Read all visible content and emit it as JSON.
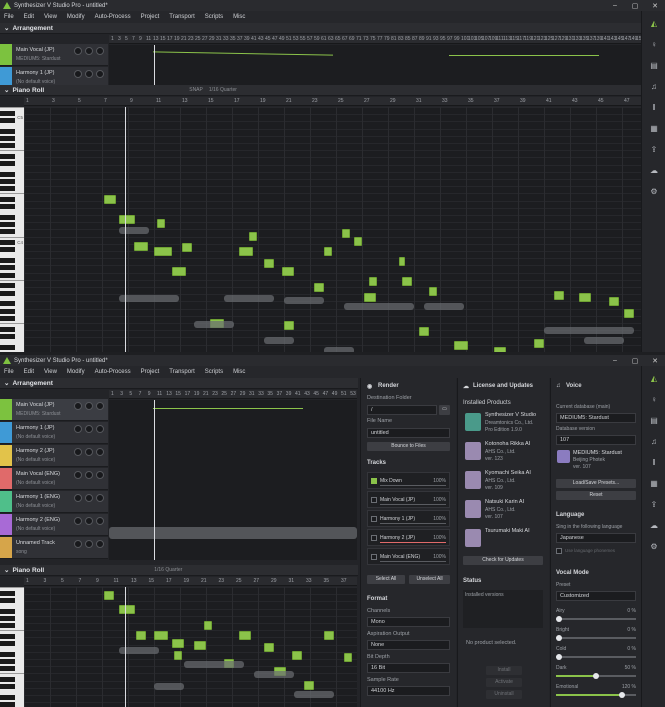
{
  "app": {
    "title": "Synthesizer V Studio Pro - untitled*"
  },
  "window_controls": {
    "min": "–",
    "max": "▢",
    "close": "✕"
  },
  "menu": [
    "File",
    "Edit",
    "View",
    "Modify",
    "Auto-Process",
    "Project",
    "Transport",
    "Scripts",
    "Misc"
  ],
  "arrangement": {
    "label": "Arrangement"
  },
  "piano_roll": {
    "label": "Piano Roll",
    "snap": "SNAP",
    "quantize": "1/16 Quarter"
  },
  "ruler1": [
    "1",
    "3",
    "5",
    "7",
    "9",
    "11",
    "13",
    "15",
    "17",
    "19",
    "21",
    "23",
    "25",
    "27",
    "29",
    "31",
    "33",
    "35",
    "37",
    "39",
    "41",
    "43",
    "45",
    "47",
    "49",
    "51",
    "53",
    "55",
    "57",
    "59",
    "61",
    "63",
    "65",
    "67",
    "69",
    "71",
    "73",
    "75",
    "77",
    "79",
    "81",
    "83",
    "85",
    "87",
    "89",
    "91",
    "93",
    "95",
    "97",
    "99",
    "101",
    "103",
    "105",
    "107",
    "109",
    "111",
    "113",
    "115",
    "117",
    "119",
    "121",
    "123",
    "125",
    "127",
    "129",
    "131",
    "133",
    "135",
    "137",
    "139",
    "141",
    "143",
    "145",
    "147",
    "149",
    "150"
  ],
  "ruler_piano": [
    "1",
    "3",
    "5",
    "7",
    "9",
    "11",
    "13",
    "15",
    "17",
    "19",
    "21",
    "23",
    "25",
    "27",
    "29",
    "31",
    "33",
    "35",
    "37",
    "39",
    "41",
    "43",
    "45",
    "47"
  ],
  "ruler2": [
    "1",
    "3",
    "5",
    "7",
    "9",
    "11",
    "13",
    "15",
    "17",
    "19",
    "21",
    "23",
    "25",
    "27",
    "29",
    "31",
    "33",
    "35",
    "37",
    "39",
    "41",
    "43",
    "45",
    "47",
    "49",
    "51",
    "53"
  ],
  "ruler_piano2": [
    "1",
    "3",
    "5",
    "7",
    "9",
    "11",
    "13",
    "15",
    "17",
    "19",
    "21",
    "23",
    "25",
    "27",
    "29",
    "31",
    "33",
    "35",
    "37"
  ],
  "tracks_top": [
    {
      "name": "Main Vocal (JP)",
      "voice": "MEDIUM5: Stardust",
      "color": "#7cc23f"
    },
    {
      "name": "Harmony 1 (JP)",
      "voice": "(No default voice)",
      "color": "#3f9ad6"
    }
  ],
  "tracks_bottom": [
    {
      "name": "Main Vocal (JP)",
      "voice": "MEDIUM5: Stardust",
      "color": "#7cc23f"
    },
    {
      "name": "Harmony 1 (JP)",
      "voice": "(No default voice)",
      "color": "#3f9ad6"
    },
    {
      "name": "Harmony 2 (JP)",
      "voice": "(No default voice)",
      "color": "#e2c34a"
    },
    {
      "name": "Main Vocal (ENG)",
      "voice": "(No default voice)",
      "color": "#e06a6a"
    },
    {
      "name": "Harmony 1 (ENG)",
      "voice": "(No default voice)",
      "color": "#4fbf8a"
    },
    {
      "name": "Harmony 2 (ENG)",
      "voice": "(No default voice)",
      "color": "#a86ad6"
    },
    {
      "name": "Unnamed Track",
      "voice": "song",
      "color": "#d6a54a"
    }
  ],
  "piano_octaves": [
    "C5",
    "C4"
  ],
  "render": {
    "title": "Render",
    "dest_label": "Destination Folder",
    "dest_value": "/",
    "file_label": "File Name",
    "file_value": "untitled",
    "browse": "Bounce to Files",
    "tracks_label": "Tracks",
    "tracks": [
      {
        "name": "Mix Down",
        "pct": "100%"
      },
      {
        "name": "Main Vocal (JP)",
        "pct": "100%"
      },
      {
        "name": "Harmony 1 (JP)",
        "pct": "100%"
      },
      {
        "name": "Harmony 2 (JP)",
        "pct": "100%"
      },
      {
        "name": "Main Vocal (ENG)",
        "pct": "100%"
      }
    ],
    "select_all": "Select All",
    "unselect_all": "Unselect All",
    "format_label": "Format",
    "channels_label": "Channels",
    "channels_value": "Mono",
    "aspiration_label": "Aspiration Output",
    "aspiration_value": "None",
    "bitdepth_label": "Bit Depth",
    "bitdepth_value": "16 Bit",
    "samplerate_label": "Sample Rate",
    "samplerate_value": "44100 Hz"
  },
  "license": {
    "title": "License and Updates",
    "installed_label": "Installed Products",
    "products": [
      {
        "name": "Synthesizer V Studio",
        "vendor": "Dreamtonics Co., Ltd.",
        "ver": "Pro Edition 1.9.0"
      },
      {
        "name": "Kotonoha Rikka AI",
        "vendor": "AHS Co., Ltd.",
        "ver": "ver. 123"
      },
      {
        "name": "Kyomachi Seika AI",
        "vendor": "AHS Co., Ltd.",
        "ver": "ver. 109"
      },
      {
        "name": "Natsuki Karin AI",
        "vendor": "AHS Co., Ltd.",
        "ver": "ver. 107"
      },
      {
        "name": "Tsurumaki Maki AI",
        "vendor": "",
        "ver": ""
      }
    ],
    "check_updates": "Check for Updates",
    "status_label": "Status",
    "installed_versions": "Installed versions",
    "no_product": "No product selected.",
    "btn1": "Install",
    "btn2": "Activate",
    "btn3": "Uninstall"
  },
  "voice": {
    "title": "Voice",
    "current_db_label": "Current database (main)",
    "current_db_value": "MEDIUM5: Stardust",
    "db_version_label": "Database version",
    "db_version_value": "107",
    "card_name": "MEDIUM5: Stardust",
    "card_vendor": "Beijing Photek",
    "card_ver": "ver. 107",
    "load_presets": "Load/Save Presets...",
    "reset": "Reset",
    "language_label": "Language",
    "sing_label": "Sing in the following language",
    "language_value": "Japanese",
    "use_phonemes": "Use language phonemes",
    "vocal_mode_label": "Vocal Mode",
    "preset_label": "Preset",
    "preset_value": "Customized",
    "sliders": [
      {
        "label": "Airy",
        "value": "0 %",
        "level": 0.0
      },
      {
        "label": "Bright",
        "value": "0 %",
        "level": 0.0
      },
      {
        "label": "Cold",
        "value": "0 %",
        "level": 0.0
      },
      {
        "label": "Dark",
        "value": "50 %",
        "level": 0.5
      },
      {
        "label": "Emotional",
        "value": "120 %",
        "level": 0.85
      }
    ]
  },
  "colors": {
    "accent": "#8bc34a",
    "bg": "#1e1f22",
    "panel": "#26272b"
  },
  "sidebar_icons": [
    "logo-icon",
    "mic-icon",
    "layers-icon",
    "note-icon",
    "library-icon",
    "grid-icon",
    "export-icon",
    "cloud-icon",
    "gear-icon"
  ]
}
